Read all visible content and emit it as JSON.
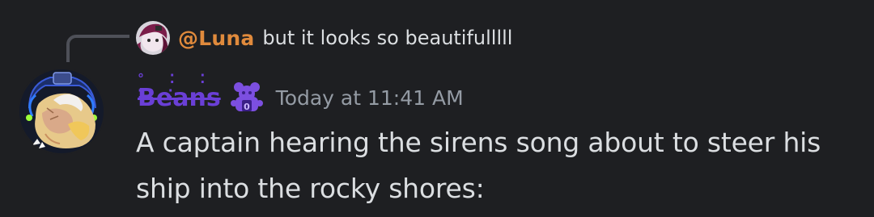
{
  "reply": {
    "author": "@Luna",
    "text": "but it looks so beautifulllll"
  },
  "message": {
    "username": "Beans",
    "username_diacritics": "° ⁚ ⁚ ⁚ ⁚",
    "timestamp": "Today at 11:41 AM",
    "content": "A captain hearing the sirens song about to steer his ship into the rocky shores:"
  },
  "colors": {
    "background": "#1e1f22",
    "reply_author": "#e08a3c",
    "username": "#6a3fd6",
    "timestamp": "#949ba4",
    "text": "#dbdee1"
  },
  "icons": {
    "role_icon": "purple-animatronic-role-icon",
    "reply_avatar": "luna-avatar",
    "author_avatar": "beans-avatar"
  }
}
